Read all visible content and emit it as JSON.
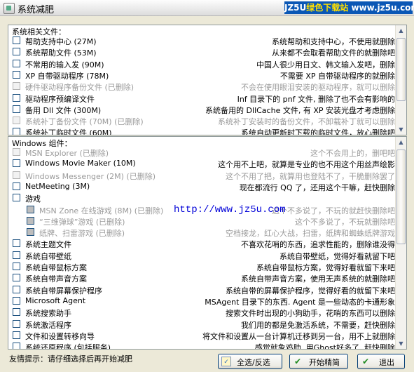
{
  "window": {
    "title": "系统减肥",
    "brand_a": "JZ5U",
    "brand_b": "绿色下载站",
    "brand_c": "www.jz5u.com"
  },
  "sys_group": {
    "legend": "系统相关文件：",
    "items": [
      {
        "name": "帮助支持中心 (27M)",
        "desc": "系统帮助和支持中心，不使用就删除",
        "disabled": false
      },
      {
        "name": "系统帮助文件 (53M)",
        "desc": "从来都不会取看帮助文件的就删除吧",
        "disabled": false
      },
      {
        "name": "不常用的输入发 (90M)",
        "desc": "中国人很少用日文、韩文输入发吧，删除",
        "disabled": false
      },
      {
        "name": "XP 自带驱动程序 (78M)",
        "desc": "不需要 XP 自带驱动程序的就删除",
        "disabled": false
      },
      {
        "name": "硬件驱动程序备份文件 (已删除)",
        "desc": "不会在使用眼泪安装的驱动程序，就可以删除",
        "disabled": true
      },
      {
        "name": "驱动程序预编译文件",
        "desc": "Inf 目录下的 pnf 文件, 删除了也不会有影响的",
        "disabled": false
      },
      {
        "name": "备用 Dll 文件 (300M)",
        "desc": "系统备用的 DllCache 文件, 有 XP 安装光盘才考虑删除",
        "disabled": false
      },
      {
        "name": "系统补丁备份文件 (70M) (已删除)",
        "desc": "系统补丁安装时的备份文件，不卸载补丁就可以删除",
        "disabled": true
      },
      {
        "name": "系统补丁临时文件 (60M)",
        "desc": "系统自动更新时下载的临时文件，放心删除吧",
        "disabled": false
      }
    ]
  },
  "win_group": {
    "legend": "Windows 组件：",
    "items": [
      {
        "name": "MSN Explorer (已删除)",
        "desc": "这个不会用上的，删吧吧",
        "disabled": true,
        "indent": 0
      },
      {
        "name": "Windows Movie Maker (10M)",
        "desc": "这个用不上吧，就算是专业的也不用这个用丝声绘影",
        "disabled": false,
        "indent": 0
      },
      {
        "name": "Windows Messenger (2M) (已删除)",
        "desc": "这个不用了把，就算用也登陆不了，干脆删除罢了",
        "disabled": true,
        "indent": 0
      },
      {
        "name": "NetMeeting (3M)",
        "desc": "现在都流行 QQ 了，还用这个干嘛，赶快删除",
        "disabled": false,
        "indent": 0
      },
      {
        "name": "游戏",
        "desc": "",
        "disabled": false,
        "indent": 0
      },
      {
        "name": "MSN Zone 在线游戏 (8M) (已删除)",
        "desc": "这个不多说了，不玩的就赶快删除吧",
        "disabled": true,
        "indent": 1
      },
      {
        "name": "“三维弹球”游戏 (已删除)",
        "desc": "这个不多说了，不玩就删除吧",
        "disabled": true,
        "indent": 1
      },
      {
        "name": "纸牌、扫雷游戏 (已删除)",
        "desc": "空档接龙，红心大战，扫雷，纸牌和蜘蛛纸牌游戏",
        "disabled": true,
        "indent": 1
      },
      {
        "name": "系统主题文件",
        "desc": "不喜欢花哨的东西，追求性能的，删除谁没得",
        "disabled": false,
        "indent": 0
      },
      {
        "name": "系统自带壁纸",
        "desc": "系统自带壁纸，觉得好看就留下吧",
        "disabled": false,
        "indent": 0
      },
      {
        "name": "系统自带鼠标方案",
        "desc": "系统自带鼠标方案，觉得好看就留下来吧",
        "disabled": false,
        "indent": 0
      },
      {
        "name": "系统自带声音方案",
        "desc": "系统自带声音方案，使用无声系统的就删除吧",
        "disabled": false,
        "indent": 0
      },
      {
        "name": "系统自带屏幕保护程序",
        "desc": "系统自带的屏幕保护程序，觉得好看的就留下来吧",
        "disabled": false,
        "indent": 0
      },
      {
        "name": "Microsoft Agent",
        "desc": "MSAgent 目录下的东西. Agent 是一些动态的卡通形象",
        "disabled": false,
        "indent": 0
      },
      {
        "name": "系统搜索助手",
        "desc": "搜索文件时出现的小狗助手，花哨的东西可以删除",
        "disabled": false,
        "indent": 0
      },
      {
        "name": "系统激活程序",
        "desc": "我们用的都是免激活系统，不需要，赶快删除",
        "disabled": false,
        "indent": 0
      },
      {
        "name": "文件和设置转移向导",
        "desc": "将文件和设置从一台计算机迁移到另一台，用不上就删除",
        "disabled": false,
        "indent": 0
      },
      {
        "name": "系统还原程序 (包括服务)",
        "desc": "感觉就象鸡肋, 用Ghost好多了, 赶快删除",
        "disabled": false,
        "indent": 0
      }
    ]
  },
  "watermark": "http://www.jz5u.com",
  "hint": "友情提示：请仔细选择后再开始减肥",
  "buttons": {
    "select_all": "全选/反选",
    "start": "开始精简",
    "exit": "退出"
  }
}
